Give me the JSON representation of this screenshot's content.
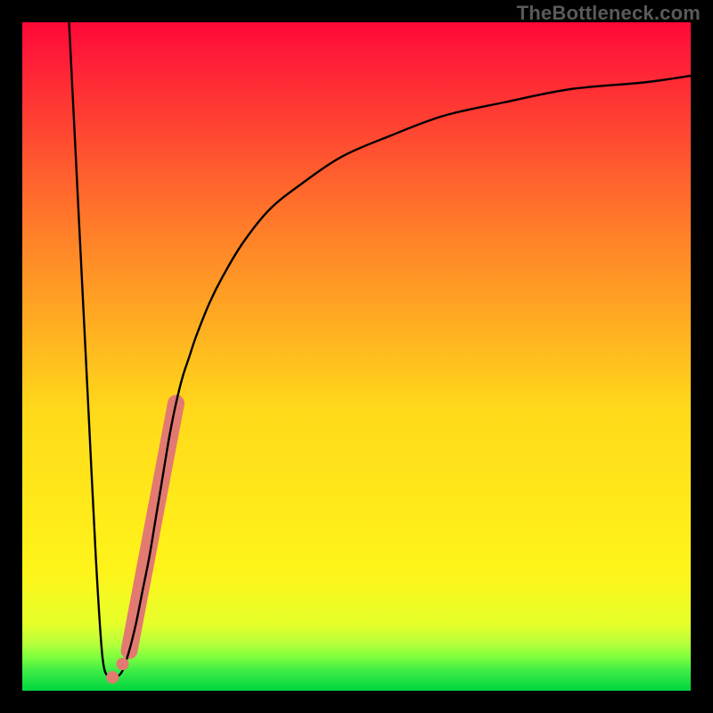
{
  "attribution": "TheBottleneck.com",
  "frame": {
    "outer": 800,
    "inset": 25,
    "bg_gradient": [
      "#ff0033",
      "#ffe100",
      "#00d939"
    ]
  },
  "chart_data": {
    "type": "line",
    "title": "",
    "xlabel": "",
    "ylabel": "",
    "xlim": [
      0,
      100
    ],
    "ylim": [
      0,
      100
    ],
    "grid": false,
    "series": [
      {
        "name": "bottleneck-curve",
        "color": "#000000",
        "x": [
          7,
          8,
          9,
          10,
          11,
          12,
          13,
          14,
          15,
          16,
          17,
          18,
          19,
          20,
          21,
          22,
          23,
          24,
          25,
          26,
          28,
          30,
          33,
          37,
          42,
          48,
          55,
          63,
          72,
          82,
          93,
          100
        ],
        "y": [
          100,
          80,
          60,
          40,
          20,
          5,
          2,
          2,
          3,
          6,
          10,
          15,
          20,
          26,
          32,
          38,
          43,
          47,
          50,
          53,
          58,
          62,
          67,
          72,
          76,
          80,
          83,
          86,
          88,
          90,
          91,
          92
        ]
      }
    ],
    "annotations": {
      "accent_band": {
        "description": "thick salmon segment along rising limb",
        "color": "#e27a72",
        "x1": 16,
        "y1": 6,
        "x2": 23,
        "y2": 43
      },
      "accent_dots": {
        "description": "two salmon dots near the valley",
        "color": "#e27a72",
        "points": [
          {
            "x": 13.5,
            "y": 2
          },
          {
            "x": 15.0,
            "y": 4
          }
        ]
      }
    }
  }
}
